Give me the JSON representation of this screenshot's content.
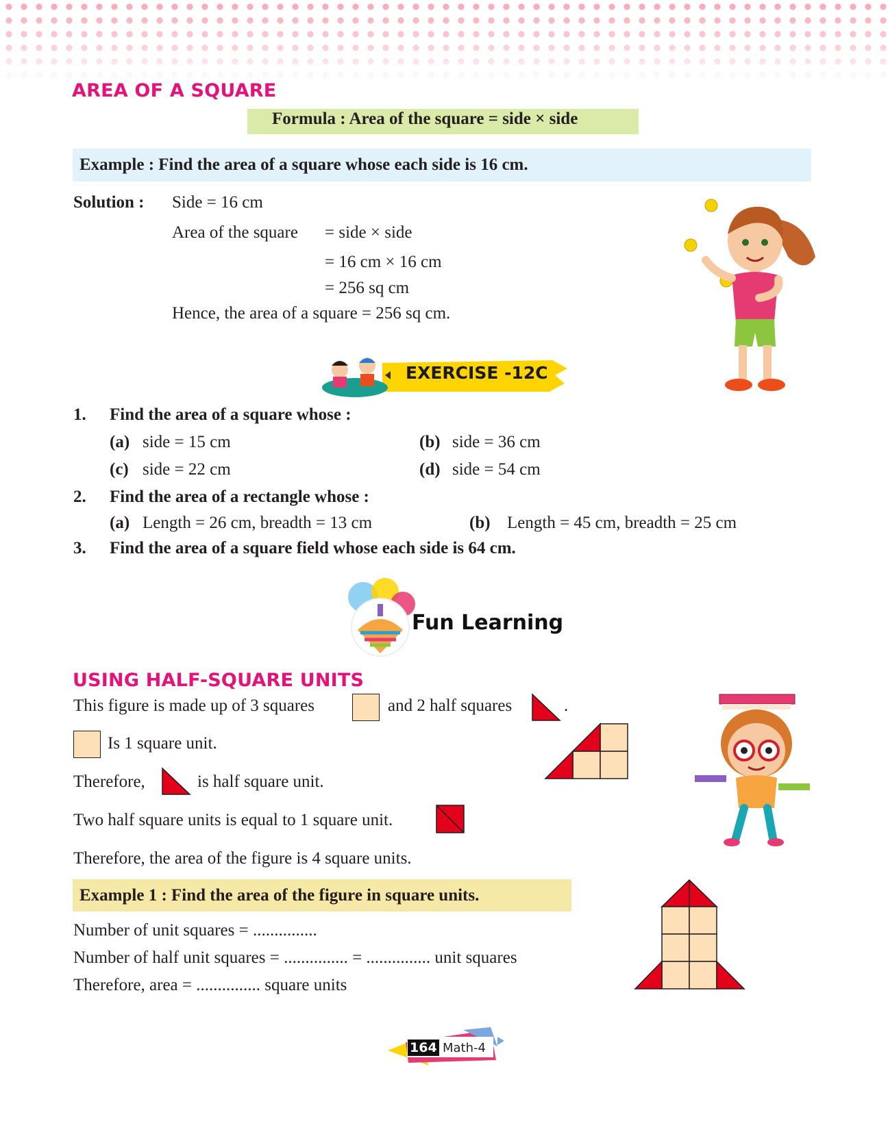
{
  "section1": {
    "title": "AREA OF A SQUARE",
    "formula": "Formula : Area of the square = side × side",
    "example": "Example : Find the area of a square whose each side is 16 cm.",
    "solution_label": "Solution :",
    "lines": [
      "Side = 16 cm",
      "Area of the square",
      "= side × side",
      "= 16 cm × 16 cm",
      "= 256 sq cm",
      "Hence, the area of a square = 256 sq cm."
    ]
  },
  "exercise": {
    "banner": "EXERCISE -12C",
    "q1": {
      "num": "1.",
      "text": "Find the area of a square whose :",
      "parts": [
        {
          "label": "(a)",
          "text": "side = 15 cm"
        },
        {
          "label": "(b)",
          "text": "side = 36 cm"
        },
        {
          "label": "(c)",
          "text": "side = 22 cm"
        },
        {
          "label": "(d)",
          "text": "side = 54 cm"
        }
      ]
    },
    "q2": {
      "num": "2.",
      "text": "Find the area of a rectangle whose :",
      "parts": [
        {
          "label": "(a)",
          "text": "Length = 26 cm, breadth = 13 cm"
        },
        {
          "label": "(b)",
          "text": "Length = 45 cm, breadth = 25 cm"
        }
      ]
    },
    "q3": {
      "num": "3.",
      "text": "Find the area of a square field whose each side is 64 cm."
    }
  },
  "fun_learning": {
    "label": "Fun Learning"
  },
  "section2": {
    "title": "USING HALF-SQUARE UNITS",
    "line1a": "This figure is made up of 3 squares",
    "line1b": "and 2 half squares",
    "line1c": ".",
    "line2": "Is 1 square unit.",
    "line3a": "Therefore,",
    "line3b": "is half square unit.",
    "line4": "Two half square units is equal to 1 square unit.",
    "line5": "Therefore, the area of the figure is 4 square units.",
    "example1": "Example 1 : Find the area of the figure in square units.",
    "answers": [
      "Number of unit squares = ...............",
      "Number of half unit squares = ............... = ............... unit squares",
      "Therefore, area = ............... square units"
    ]
  },
  "footer": {
    "page": "164",
    "book": "Math-4"
  },
  "colors": {
    "heading": "#e4137b",
    "formula_band": "#d9eaa9",
    "example_band": "#e2f2fa",
    "example1_band": "#f6e8a6",
    "square_fill": "#fddfb8",
    "triangle_red": "#e2001a"
  }
}
